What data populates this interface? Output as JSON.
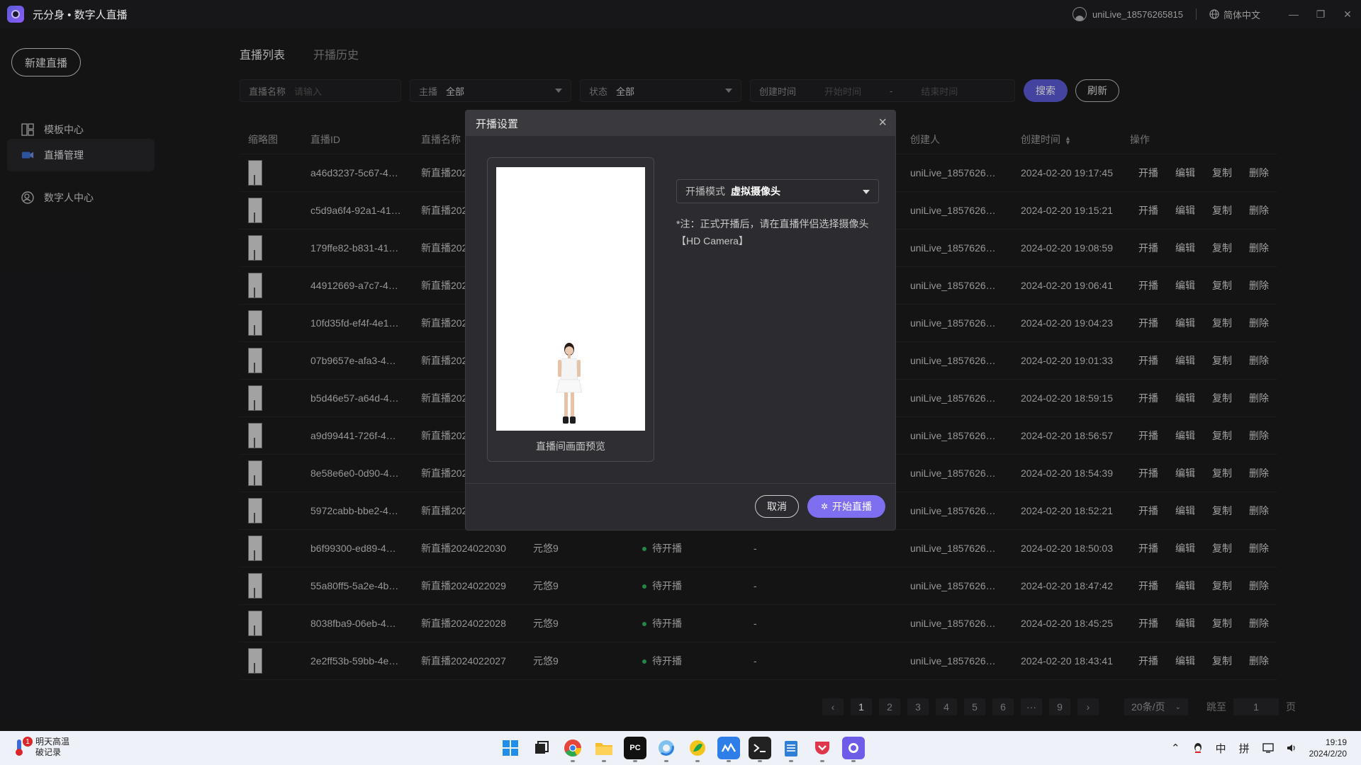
{
  "app": {
    "title": "元分身 • 数字人直播"
  },
  "titlebar": {
    "user": "uniLive_18576265815",
    "language": "简体中文"
  },
  "sidebar": {
    "new_button": "新建直播",
    "items": [
      {
        "label": "模板中心",
        "icon": "template-grid-icon",
        "active": false
      },
      {
        "label": "直播管理",
        "icon": "camera-icon",
        "active": true
      },
      {
        "label": "数字人中心",
        "icon": "digital-human-icon",
        "active": false
      }
    ]
  },
  "tabs": [
    {
      "label": "直播列表",
      "active": true
    },
    {
      "label": "开播历史",
      "active": false
    }
  ],
  "filters": {
    "name_label": "直播名称",
    "name_placeholder": "请输入",
    "host_label": "主播",
    "host_value": "全部",
    "status_label": "状态",
    "status_value": "全部",
    "created_label": "创建时间",
    "start_placeholder": "开始时间",
    "dash": "-",
    "end_placeholder": "结束时间",
    "search_label": "搜索",
    "refresh_label": "刷新"
  },
  "table": {
    "headers": {
      "thumb": "缩略图",
      "id": "直播ID",
      "name": "直播名称",
      "creator": "创建人",
      "created": "创建时间",
      "ops": "操作"
    },
    "ops": [
      "开播",
      "编辑",
      "复制",
      "删除"
    ],
    "rows": [
      {
        "id": "a46d3237-5c67-4…",
        "name": "新直播2024022040",
        "host": "",
        "status": "",
        "extra": "",
        "creator": "uniLive_1857626…",
        "created": "2024-02-20 19:17:45"
      },
      {
        "id": "c5d9a6f4-92a1-41…",
        "name": "新直播2024022039",
        "host": "",
        "status": "",
        "extra": "",
        "creator": "uniLive_1857626…",
        "created": "2024-02-20 19:15:21"
      },
      {
        "id": "179ffe82-b831-41…",
        "name": "新直播2024022038",
        "host": "",
        "status": "",
        "extra": "",
        "creator": "uniLive_1857626…",
        "created": "2024-02-20 19:08:59"
      },
      {
        "id": "44912669-a7c7-4…",
        "name": "新直播2024022037",
        "host": "",
        "status": "",
        "extra": "",
        "creator": "uniLive_1857626…",
        "created": "2024-02-20 19:06:41"
      },
      {
        "id": "10fd35fd-ef4f-4e1…",
        "name": "新直播2024022036",
        "host": "",
        "status": "",
        "extra": "",
        "creator": "uniLive_1857626…",
        "created": "2024-02-20 19:04:23"
      },
      {
        "id": "07b9657e-afa3-4…",
        "name": "新直播2024022035",
        "host": "",
        "status": "",
        "extra": "",
        "creator": "uniLive_1857626…",
        "created": "2024-02-20 19:01:33"
      },
      {
        "id": "b5d46e57-a64d-4…",
        "name": "新直播2024022034",
        "host": "",
        "status": "",
        "extra": "",
        "creator": "uniLive_1857626…",
        "created": "2024-02-20 18:59:15"
      },
      {
        "id": "a9d99441-726f-4…",
        "name": "新直播2024022033",
        "host": "",
        "status": "",
        "extra": "",
        "creator": "uniLive_1857626…",
        "created": "2024-02-20 18:56:57"
      },
      {
        "id": "8e58e6e0-0d90-4…",
        "name": "新直播2024022032",
        "host": "",
        "status": "",
        "extra": "",
        "creator": "uniLive_1857626…",
        "created": "2024-02-20 18:54:39"
      },
      {
        "id": "5972cabb-bbe2-4…",
        "name": "新直播2024022031",
        "host": "",
        "status": "",
        "extra": "",
        "creator": "uniLive_1857626…",
        "created": "2024-02-20 18:52:21"
      },
      {
        "id": "b6f99300-ed89-4…",
        "name": "新直播2024022030",
        "host": "元悠9",
        "status": "待开播",
        "extra": "-",
        "creator": "uniLive_1857626…",
        "created": "2024-02-20 18:50:03"
      },
      {
        "id": "55a80ff5-5a2e-4b…",
        "name": "新直播2024022029",
        "host": "元悠9",
        "status": "待开播",
        "extra": "-",
        "creator": "uniLive_1857626…",
        "created": "2024-02-20 18:47:42"
      },
      {
        "id": "8038fba9-06eb-4…",
        "name": "新直播2024022028",
        "host": "元悠9",
        "status": "待开播",
        "extra": "-",
        "creator": "uniLive_1857626…",
        "created": "2024-02-20 18:45:25"
      },
      {
        "id": "2e2ff53b-59bb-4e…",
        "name": "新直播2024022027",
        "host": "元悠9",
        "status": "待开播",
        "extra": "-",
        "creator": "uniLive_1857626…",
        "created": "2024-02-20 18:43:41"
      }
    ]
  },
  "pagination": {
    "prev": "‹",
    "next": "›",
    "pages": [
      "1",
      "2",
      "3",
      "4",
      "5",
      "6",
      "···",
      "9"
    ],
    "current": "1",
    "page_size": "20条/页",
    "jump_label": "跳至",
    "jump_value": "1",
    "page_suffix": "页"
  },
  "modal": {
    "title": "开播设置",
    "preview_caption": "直播间画面预览",
    "mode_label": "开播模式",
    "mode_value": "虚拟摄像头",
    "note": "*注：正式开播后，请在直播伴侣选择摄像头【HD Camera】",
    "cancel_label": "取消",
    "start_label": "开始直播"
  },
  "taskbar": {
    "weather_line1": "明天高温",
    "weather_line2": "破记录",
    "weather_badge": "1",
    "tray_ime1": "中",
    "tray_ime2": "拼",
    "time": "19:19",
    "date": "2024/2/20"
  }
}
